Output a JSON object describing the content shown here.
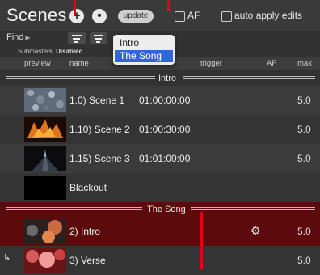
{
  "header": {
    "title": "Scenes",
    "add_label": "+",
    "second_label": "•",
    "update_label": "update",
    "af_label": "AF",
    "auto_apply_label": "auto apply edits"
  },
  "find": {
    "label": "Find"
  },
  "submasters": {
    "label": "Submasters:",
    "value": "Disabled"
  },
  "columns": [
    "preview",
    "name",
    "trigger",
    "AF",
    "max"
  ],
  "dropdown": {
    "items": [
      "Intro",
      "The Song"
    ],
    "selected": "The Song"
  },
  "groups": [
    {
      "name": "Intro"
    },
    {
      "name": "The Song"
    }
  ],
  "rows": [
    {
      "name": "1.0) Scene 1",
      "time": "01:00:00:00",
      "max": "5.0"
    },
    {
      "name": "1.10) Scene 2",
      "time": "01:00:30:00",
      "max": "5.0"
    },
    {
      "name": "1.15) Scene 3",
      "time": "01:01:00:00",
      "max": "5.0"
    },
    {
      "name": "Blackout",
      "time": "",
      "max": ""
    },
    {
      "name": "2) Intro",
      "time": "",
      "max": "5.0"
    },
    {
      "name": "3) Verse",
      "time": "",
      "max": "5.0"
    }
  ],
  "colors": {
    "selected_row": "#5b0b0b",
    "marker": "#e0001a",
    "dropdown_selected": "#2f67d6"
  }
}
